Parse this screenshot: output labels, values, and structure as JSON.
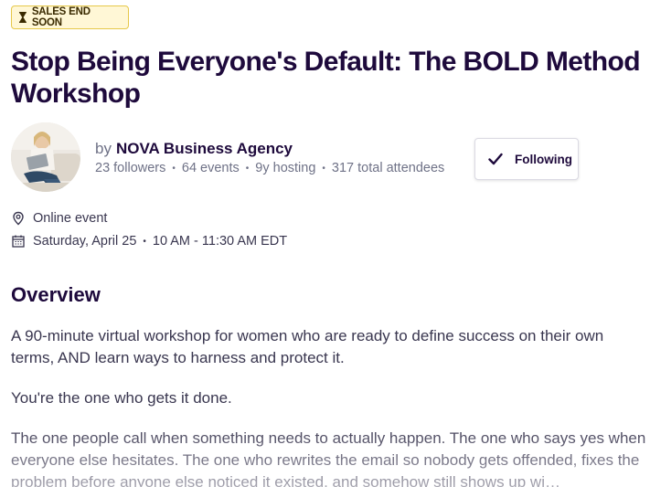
{
  "badge": {
    "icon": "hourglass-icon",
    "label": "SALES END SOON"
  },
  "event": {
    "title": "Stop Being Everyone's Default: The BOLD Method Workshop"
  },
  "organizer": {
    "by_label": "by",
    "name": "NOVA Business Agency",
    "stats": {
      "followers": "23 followers",
      "events": "64 events",
      "hosting": "9y hosting",
      "attendees": "317 total attendees"
    },
    "follow_button": {
      "label": "Following",
      "icon": "check-icon"
    }
  },
  "details": {
    "location": "Online event",
    "date": "Saturday, April 25",
    "time": "10 AM - 11:30 AM EDT"
  },
  "overview": {
    "heading": "Overview",
    "paragraphs": [
      "A 90-minute virtual workshop for women who are ready to define success on their own terms, AND learn ways to harness and protect it.",
      "You're the one who gets it done.",
      "The one people call when something needs to actually happen. The one who says yes when everyone else hesitates. The one who rewrites the email so nobody gets offended, fixes the problem before anyone else noticed it existed, and somehow still shows up wi…"
    ]
  },
  "colors": {
    "badge_bg": "#fff7d6",
    "badge_border": "#e6c84a",
    "title": "#1e0a3c",
    "muted": "#6f7287",
    "body": "#39364f"
  }
}
